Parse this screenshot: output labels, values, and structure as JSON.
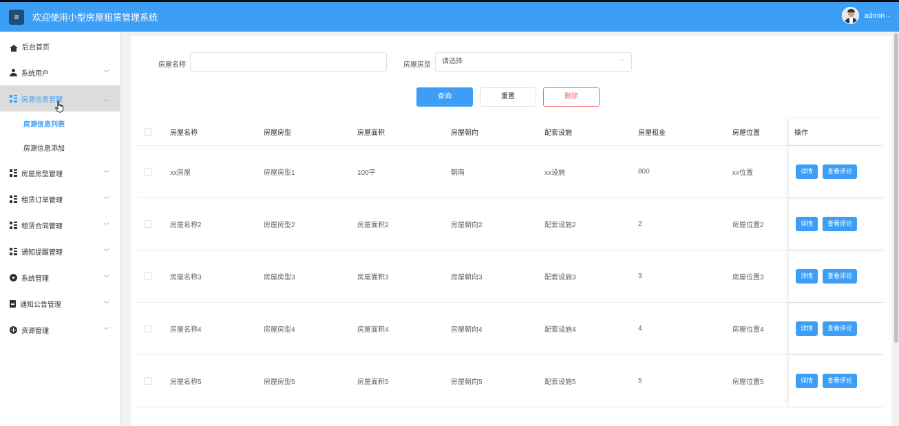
{
  "header": {
    "menu_icon": "≡",
    "title": "欢迎使用小型房屋租赁管理系统",
    "username": "admin",
    "caret": "⌄"
  },
  "sidebar": {
    "items": [
      {
        "label": "后台首页",
        "icon": "home-icon"
      },
      {
        "label": "系统用户",
        "icon": "user-icon"
      },
      {
        "label": "房源信息管理",
        "icon": "grid-icon"
      },
      {
        "label": "房屋房型管理",
        "icon": "grid-icon"
      },
      {
        "label": "租赁订单管理",
        "icon": "grid-icon"
      },
      {
        "label": "租赁合同管理",
        "icon": "grid-icon"
      },
      {
        "label": "通知提醒管理",
        "icon": "grid-icon"
      },
      {
        "label": "系统管理",
        "icon": "gear-icon"
      },
      {
        "label": "通知公告管理",
        "icon": "document-icon"
      },
      {
        "label": "资源管理",
        "icon": "plus-circle-icon"
      }
    ],
    "sub_items": [
      {
        "label": "房源信息列表"
      },
      {
        "label": "房源信息添加"
      }
    ],
    "active_color": "#3d9ef6"
  },
  "search": {
    "name_label": "房屋名称",
    "name_value": "",
    "type_label": "房屋房型",
    "type_placeholder": "请选择"
  },
  "actions": {
    "query": "查询",
    "reset": "重置",
    "delete": "删除"
  },
  "table": {
    "headers": [
      "房屋名称",
      "房屋房型",
      "房屋面积",
      "房屋朝向",
      "配套设施",
      "房屋租金",
      "房屋位置",
      "操作"
    ],
    "rows": [
      [
        "xx房屋",
        "房屋房型1",
        "100平",
        "朝南",
        "xx设施",
        "800",
        "xx位置"
      ],
      [
        "房屋名称2",
        "房屋房型2",
        "房屋面积2",
        "房屋朝向2",
        "配套设施2",
        "2",
        "房屋位置2"
      ],
      [
        "房屋名称3",
        "房屋房型3",
        "房屋面积3",
        "房屋朝向3",
        "配套设施3",
        "3",
        "房屋位置3"
      ],
      [
        "房屋名称4",
        "房屋房型4",
        "房屋面积4",
        "房屋朝向4",
        "配套设施4",
        "4",
        "房屋位置4"
      ],
      [
        "房屋名称5",
        "房屋房型5",
        "房屋面积5",
        "房屋朝向5",
        "配套设施5",
        "5",
        "房屋位置5"
      ]
    ],
    "row_actions": {
      "detail": "详情",
      "comments": "查看评论"
    }
  },
  "colors": {
    "primary": "#3d9ef6",
    "danger": "#f56c6c",
    "topbar": "#3d9ef6"
  }
}
